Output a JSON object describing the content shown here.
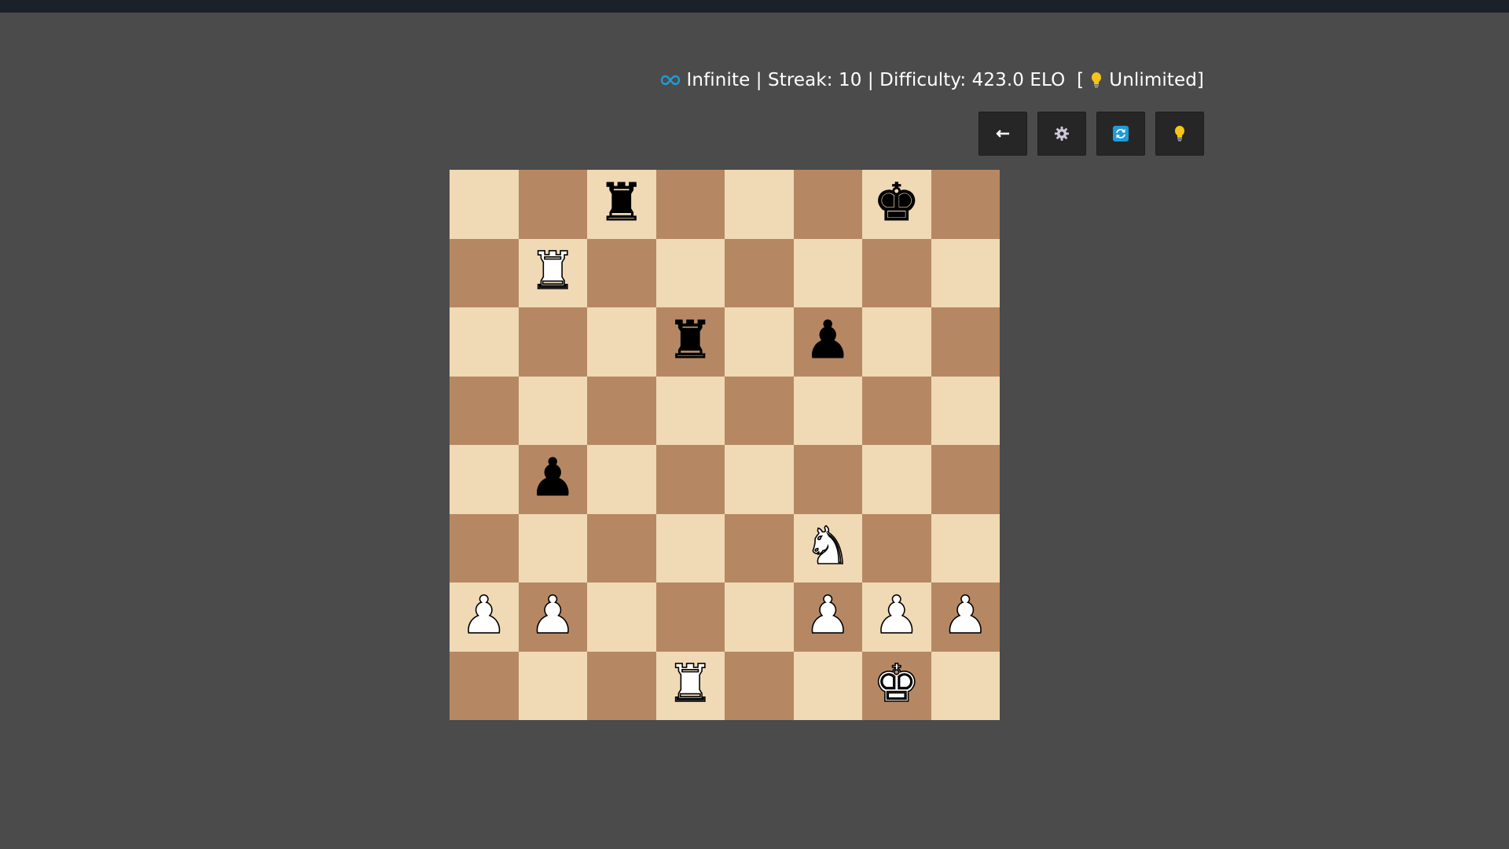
{
  "header": {
    "mode": "Infinite",
    "sep1": " | ",
    "streak": "Streak: 10",
    "sep2": " | ",
    "difficulty": "Difficulty: 423.0 ELO",
    "hints_open": "  [",
    "hints": "Unlimited]"
  },
  "toolbar": {
    "buttons": [
      {
        "name": "back-button",
        "icon": "arrow-left-icon"
      },
      {
        "name": "settings-button",
        "icon": "gear-icon"
      },
      {
        "name": "flip-board-button",
        "icon": "refresh-icon"
      },
      {
        "name": "hint-button",
        "icon": "lightbulb-icon"
      }
    ]
  },
  "colors": {
    "background": "#4b4b4b",
    "topbar": "#1b2128",
    "light_square": "#f0d9b5",
    "dark_square": "#b58863",
    "button": "#262626",
    "accent_blue": "#1e9bd7",
    "bulb_yellow": "#f5c518"
  },
  "board": {
    "orientation": "white-bottom",
    "ranks": [
      [
        "",
        "",
        "r",
        "",
        "",
        "",
        "k",
        ""
      ],
      [
        "",
        "R",
        "",
        "",
        "",
        "",
        "",
        ""
      ],
      [
        "",
        "",
        "",
        "r",
        "",
        "p",
        "",
        ""
      ],
      [
        "",
        "",
        "",
        "",
        "",
        "",
        "",
        ""
      ],
      [
        "",
        "p",
        "",
        "",
        "",
        "",
        "",
        ""
      ],
      [
        "",
        "",
        "",
        "",
        "",
        "N",
        "",
        ""
      ],
      [
        "P",
        "P",
        "",
        "",
        "",
        "P",
        "P",
        "P"
      ],
      [
        "",
        "",
        "",
        "R",
        "",
        "",
        "K",
        ""
      ]
    ]
  }
}
